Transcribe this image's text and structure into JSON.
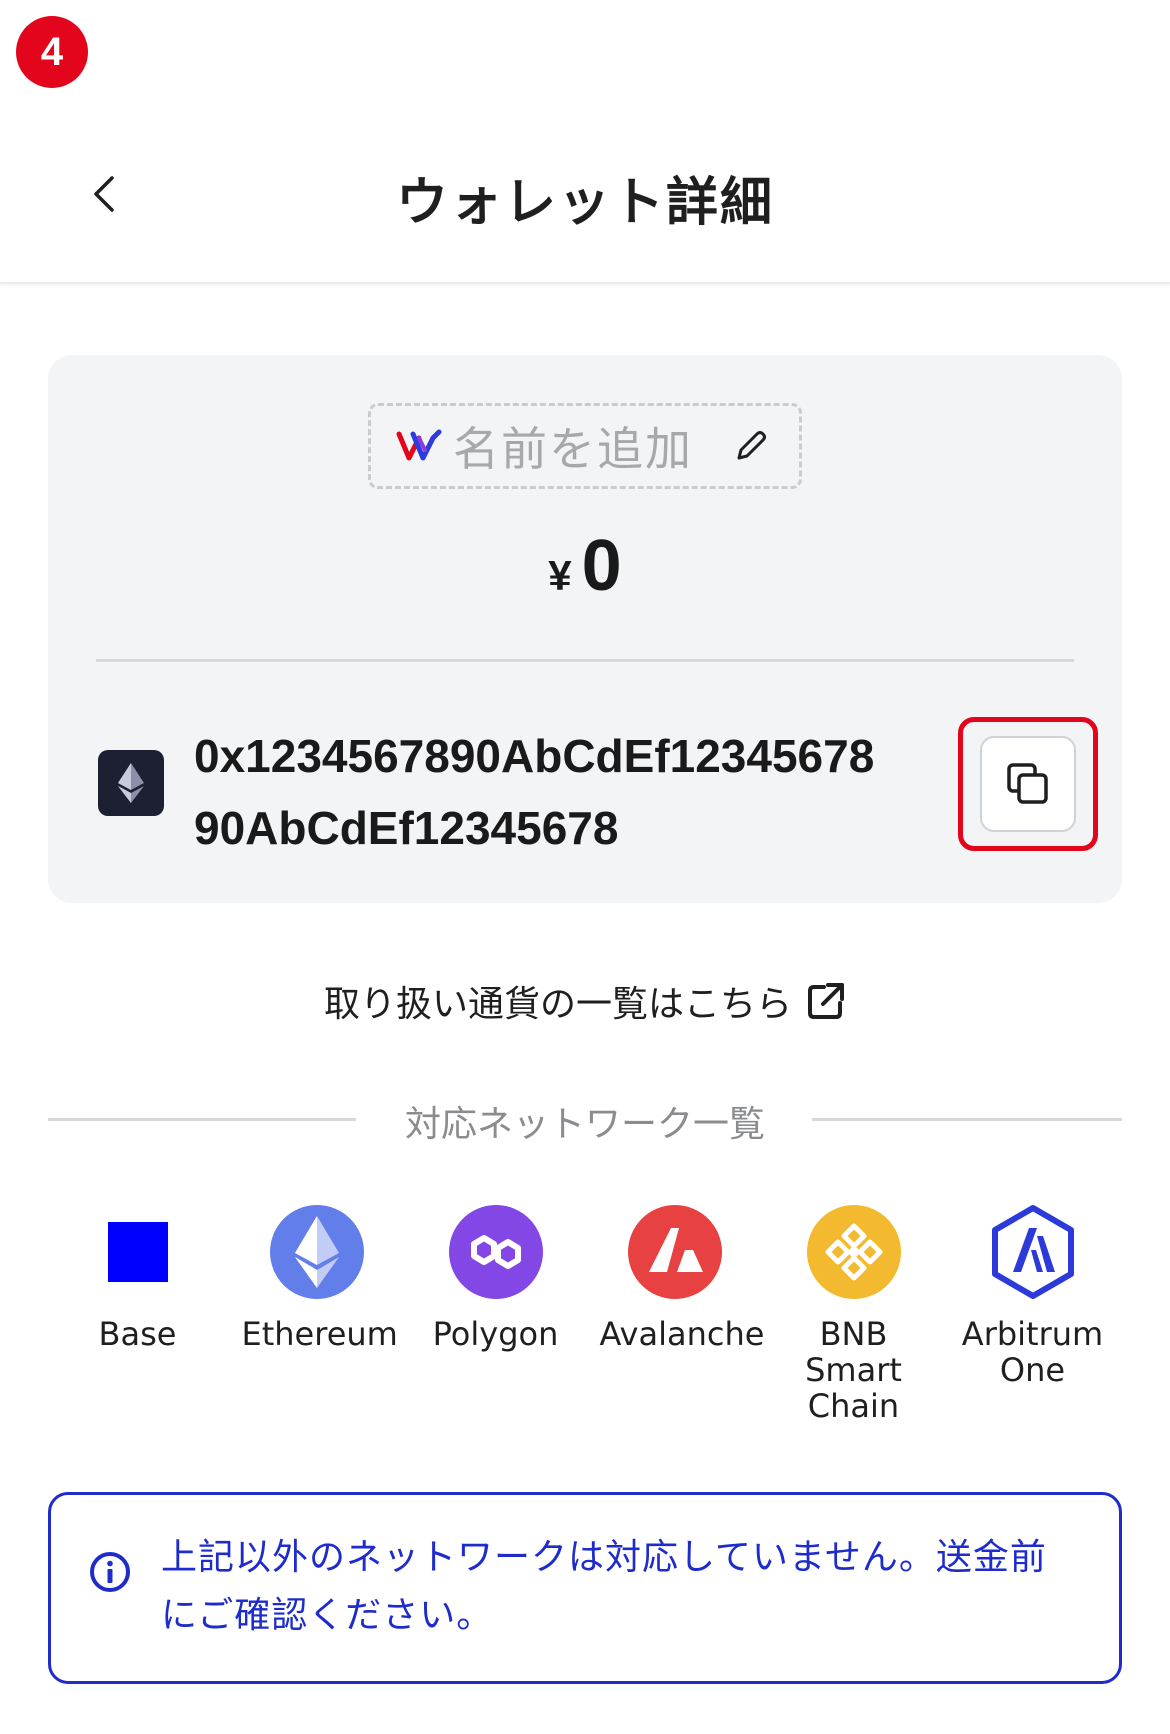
{
  "step_badge": "4",
  "header": {
    "title": "ウォレット詳細"
  },
  "wallet": {
    "name_placeholder": "名前を追加",
    "currency_symbol": "¥",
    "balance": "0",
    "address": "0x1234567890AbCdEf1234567890AbCdEf12345678"
  },
  "links": {
    "currency_list": "取り扱い通貨の一覧はこちら"
  },
  "networks": {
    "section_title": "対応ネットワーク一覧",
    "items": [
      {
        "name": "Base",
        "icon": "base-icon",
        "color": "#0000ff"
      },
      {
        "name": "Ethereum",
        "icon": "ethereum-icon",
        "color": "#627eea"
      },
      {
        "name": "Polygon",
        "icon": "polygon-icon",
        "color": "#8247e5"
      },
      {
        "name": "Avalanche",
        "icon": "avalanche-icon",
        "color": "#e84142"
      },
      {
        "name": "BNB\nSmart\nChain",
        "icon": "bnb-icon",
        "color": "#f3ba2f"
      },
      {
        "name": "Arbitrum\nOne",
        "icon": "arbitrum-icon",
        "color": "#2b3ad8"
      }
    ]
  },
  "notice": {
    "text": "上記以外のネットワークは対応していません。送金前にご確認ください。"
  },
  "colors": {
    "highlight": "#e3051b",
    "notice": "#1f2ccc",
    "card_bg": "#f3f4f6"
  }
}
